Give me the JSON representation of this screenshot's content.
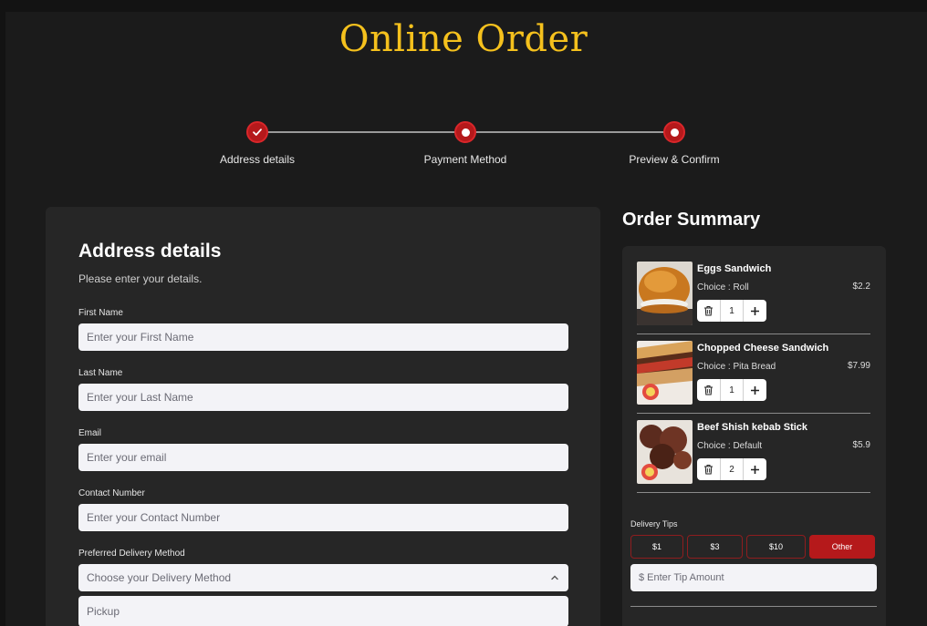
{
  "page": {
    "title": "Online Order"
  },
  "stepper": {
    "steps": [
      {
        "label": "Address details",
        "state": "done"
      },
      {
        "label": "Payment Method",
        "state": "pending"
      },
      {
        "label": "Preview & Confirm",
        "state": "pending"
      }
    ]
  },
  "address_form": {
    "title": "Address details",
    "subtitle": "Please enter your details.",
    "fields": [
      {
        "label": "First Name",
        "placeholder": "Enter your First Name",
        "value": ""
      },
      {
        "label": "Last Name",
        "placeholder": "Enter your Last Name",
        "value": ""
      },
      {
        "label": "Email",
        "placeholder": "Enter your email",
        "value": ""
      },
      {
        "label": "Contact Number",
        "placeholder": "Enter your Contact Number",
        "value": ""
      }
    ],
    "delivery": {
      "label": "Preferred Delivery Method",
      "placeholder": "Choose your Delivery Method",
      "options": [
        "Pickup"
      ]
    }
  },
  "order_summary": {
    "title": "Order Summary",
    "items": [
      {
        "name": "Eggs Sandwich",
        "choice": "Choice : Roll",
        "price": "$2.2",
        "quantity": "1"
      },
      {
        "name": "Chopped Cheese Sandwich",
        "choice": "Choice : Pita Bread",
        "price": "$7.99",
        "quantity": "1"
      },
      {
        "name": "Beef Shish kebab Stick",
        "choice": "Choice : Default",
        "price": "$5.9",
        "quantity": "2"
      }
    ],
    "tips": {
      "label": "Delivery Tips",
      "options": [
        "$1",
        "$3",
        "$10",
        "Other"
      ],
      "selected": "Other",
      "input_placeholder": "$ Enter Tip Amount"
    }
  },
  "colors": {
    "accent": "#b5191b",
    "title": "#f5c11d",
    "background": "#1b1b1b",
    "card": "#262626"
  },
  "icons": {
    "done_step": "check-icon",
    "pending_step": "dot-icon",
    "remove": "trash-icon",
    "increment": "plus-icon",
    "select": "chevron-up-icon"
  }
}
